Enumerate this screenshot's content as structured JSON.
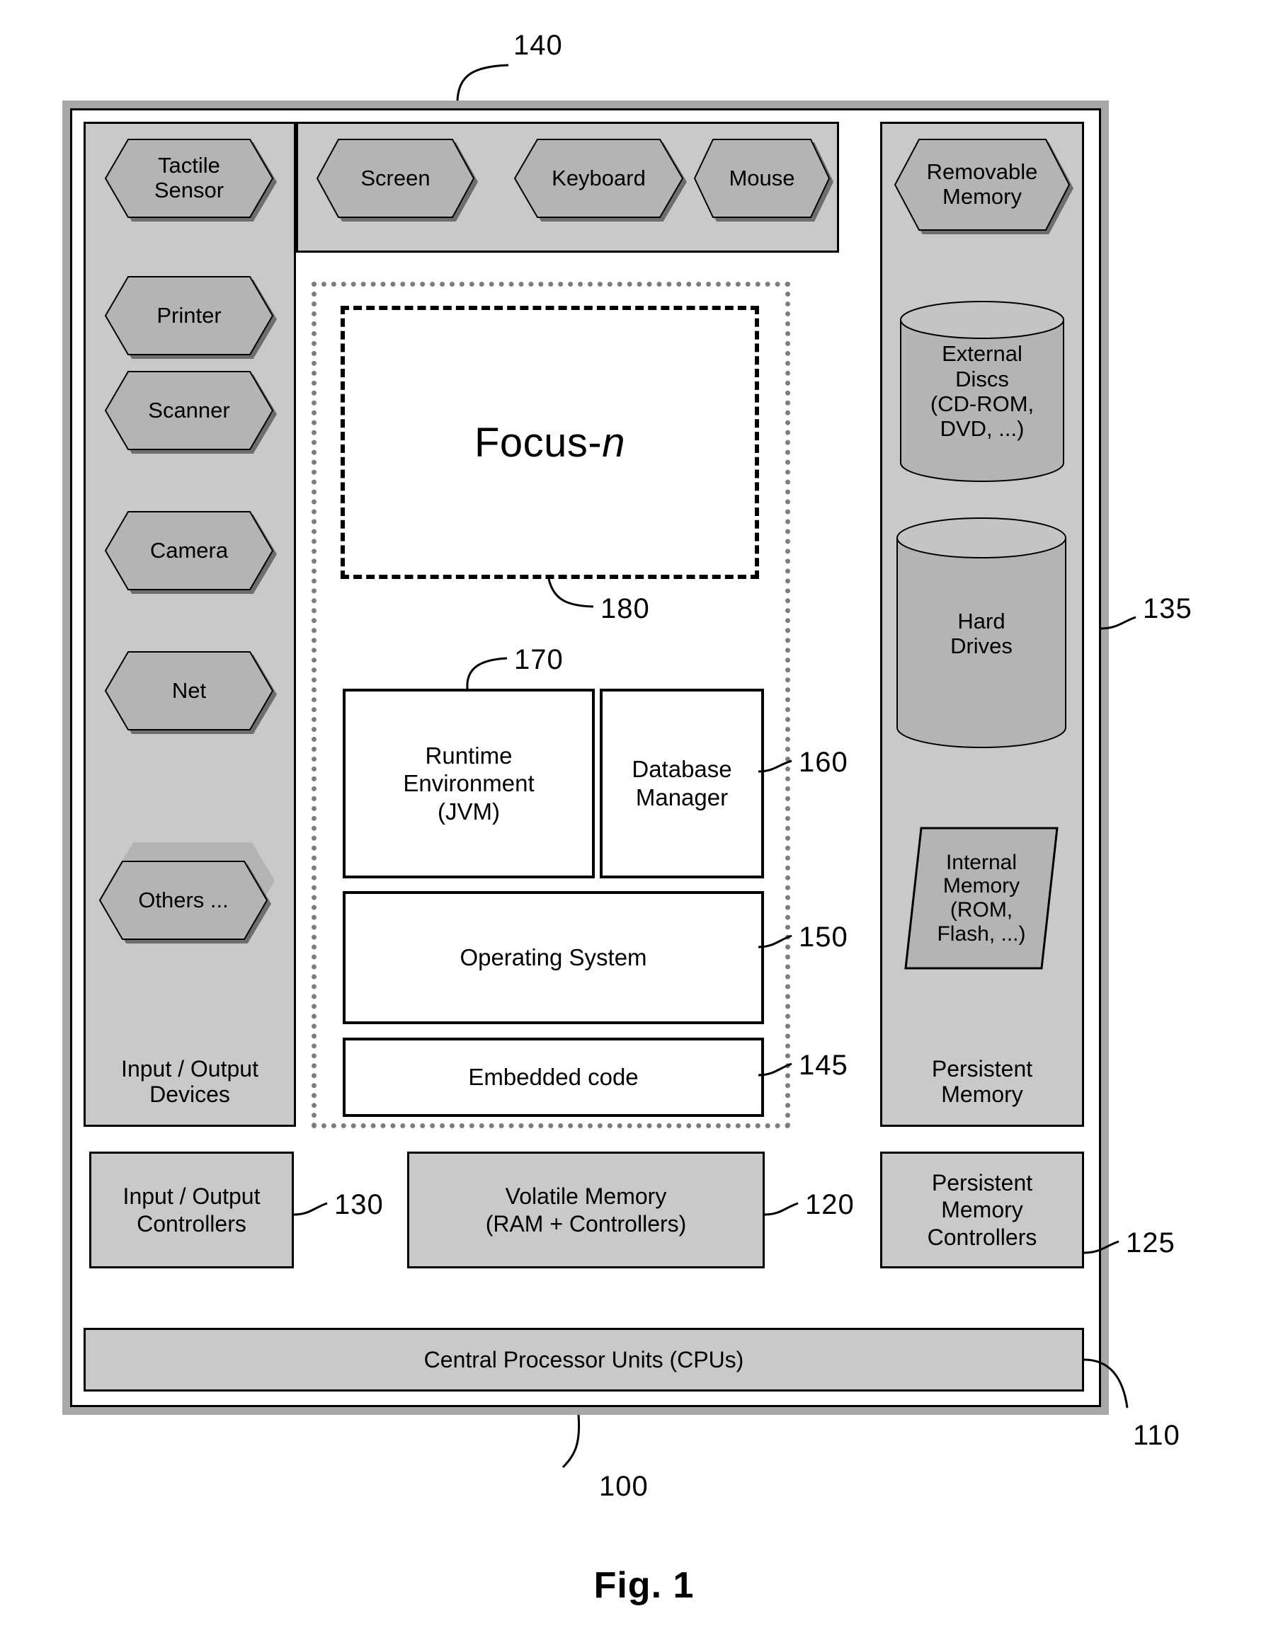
{
  "figure": {
    "caption": "Fig. 1",
    "system_ref": "100",
    "frame_ref": "110"
  },
  "io_devices_panel": {
    "caption": "Input / Output\nDevices",
    "caption_line1": "Input / Output",
    "caption_line2": "Devices",
    "devices": [
      {
        "label_line1": "Tactile",
        "label_line2": "Sensor",
        "name": "tactile-sensor"
      },
      {
        "label_line1": "Printer",
        "label_line2": "",
        "name": "printer"
      },
      {
        "label_line1": "Scanner",
        "label_line2": "",
        "name": "scanner"
      },
      {
        "label_line1": "Camera",
        "label_line2": "",
        "name": "camera"
      },
      {
        "label_line1": "Net",
        "label_line2": "",
        "name": "net"
      },
      {
        "label_line1": "Others ...",
        "label_line2": "",
        "name": "others"
      }
    ]
  },
  "top_row_panel": {
    "ref": "140",
    "devices": [
      {
        "label": "Screen",
        "name": "screen"
      },
      {
        "label": "Keyboard",
        "name": "keyboard"
      },
      {
        "label": "Mouse",
        "name": "mouse"
      }
    ]
  },
  "persistent_memory_panel": {
    "caption_line1": "Persistent",
    "caption_line2": "Memory",
    "ref": "135",
    "removable": {
      "line1": "Removable",
      "line2": "Memory"
    },
    "external_discs": {
      "line1": "External",
      "line2": "Discs",
      "line3": "(CD-ROM,",
      "line4": "DVD, ...)"
    },
    "hard_drives": {
      "line1": "Hard",
      "line2": "Drives"
    },
    "internal_memory": {
      "line1": "Internal",
      "line2": "Memory",
      "line3": "(ROM,",
      "line4": "Flash, ...)"
    }
  },
  "software_stack": {
    "focus": {
      "label_main": "Focus-",
      "label_italic": "n",
      "ref": "180"
    },
    "runtime": {
      "line1": "Runtime",
      "line2": "Environment",
      "line3": "(JVM)",
      "ref": "170"
    },
    "database_manager": {
      "line1": "Database",
      "line2": "Manager",
      "ref": "160"
    },
    "operating_system": {
      "label": "Operating System",
      "ref": "150"
    },
    "embedded_code": {
      "label": "Embedded code",
      "ref": "145"
    }
  },
  "bottom_row": {
    "io_controllers": {
      "line1": "Input / Output",
      "line2": "Controllers",
      "ref": "130"
    },
    "volatile_memory": {
      "line1": "Volatile Memory",
      "line2": "(RAM + Controllers)",
      "ref": "120"
    },
    "persistent_memory_controllers": {
      "line1": "Persistent",
      "line2": "Memory",
      "line3": "Controllers",
      "ref": "125"
    },
    "cpus": {
      "label": "Central Processor Units (CPUs)"
    }
  },
  "colors": {
    "panel_gray": "#c9c9c9",
    "shape_gray": "#b4b4b4",
    "shadow_gray": "#6e6e6e",
    "frame_gray": "#a8a8a8",
    "line_black": "#000000",
    "dash_gray": "#7d7d7d"
  }
}
